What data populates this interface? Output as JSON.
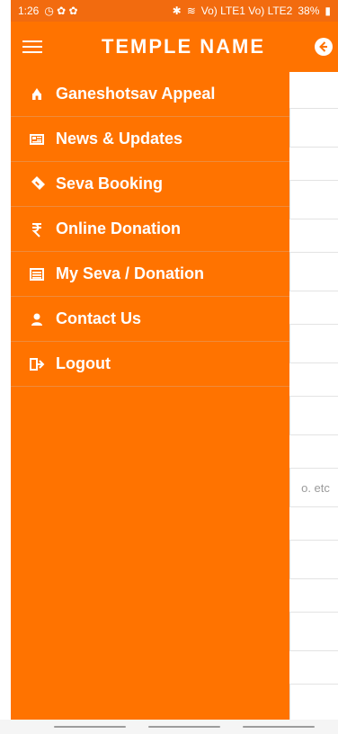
{
  "status": {
    "time": "1:26",
    "right_text": "Vo) LTE1 Vo) LTE2",
    "battery": "38%"
  },
  "app": {
    "title": "TEMPLE NAME"
  },
  "menu": {
    "items": [
      {
        "label": "Ganeshotsav Appeal",
        "icon": "temple-icon"
      },
      {
        "label": "News & Updates",
        "icon": "newspaper-icon"
      },
      {
        "label": "Seva Booking",
        "icon": "ticket-icon"
      },
      {
        "label": "Online Donation",
        "icon": "rupee-icon"
      },
      {
        "label": "My Seva / Donation",
        "icon": "list-icon"
      },
      {
        "label": "Contact Us",
        "icon": "user-icon"
      },
      {
        "label": "Logout",
        "icon": "logout-icon"
      }
    ]
  },
  "form": {
    "placeholder_partial": "o. etc"
  },
  "colors": {
    "primary": "#ff7300",
    "status": "#f26b0f"
  }
}
